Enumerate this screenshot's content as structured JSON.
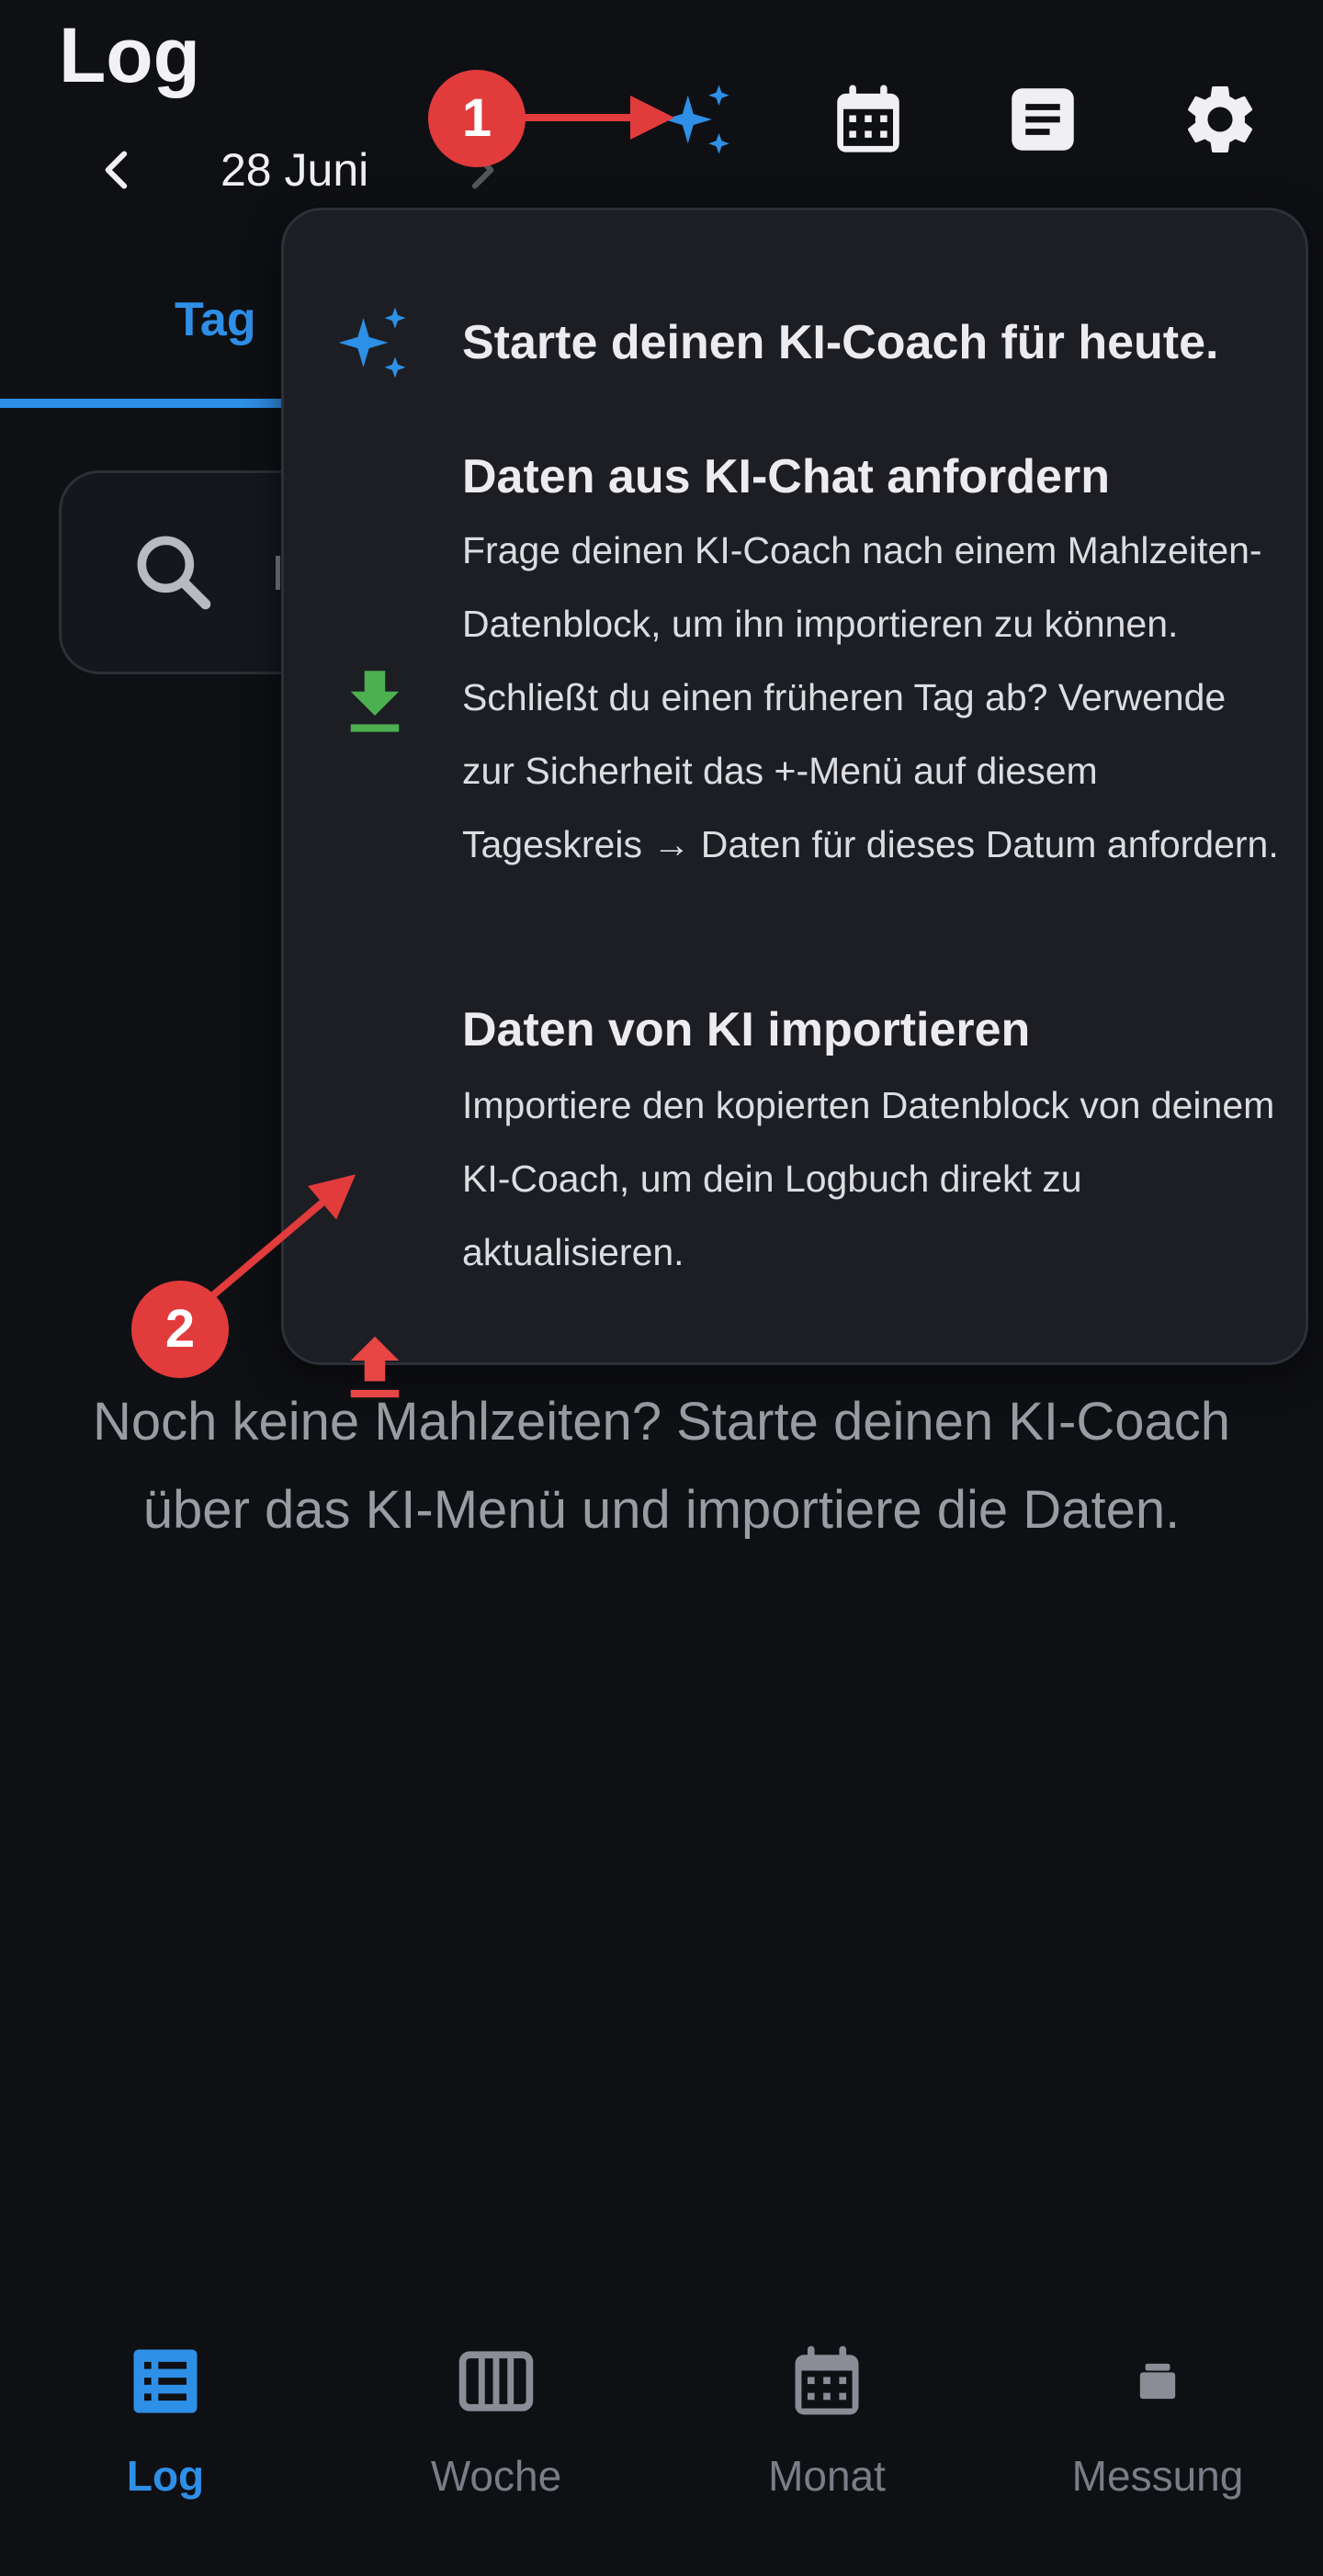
{
  "header": {
    "title": "Log",
    "date": "28 Juni"
  },
  "icons": {
    "prev": "chevron-left-icon",
    "next": "chevron-right-icon",
    "ai": "sparkles-icon",
    "calendar": "calendar-icon",
    "notes": "notes-icon",
    "settings": "gear-icon"
  },
  "tabs": {
    "active": "Tag"
  },
  "search": {
    "placeholder": "I"
  },
  "empty_state": "Noch keine Mahlzeiten? Starte deinen KI-Coach über das KI-Menü und importiere die Daten.",
  "ai_menu": {
    "start_label": "Starte deinen KI-Coach für heute.",
    "request": {
      "title": "Daten aus KI-Chat anfordern",
      "description": "Frage deinen KI-Coach nach einem Mahlzeiten-Datenblock, um ihn importieren zu können. Schließt du einen früheren Tag ab? Verwende zur Sicherheit das +-Menü auf diesem Tageskreis → Daten für dieses Datum anfordern."
    },
    "import": {
      "title": "Daten von KI importieren",
      "description": "Importiere den kopierten Datenblock von deinem KI-Coach, um dein Logbuch direkt zu aktualisieren."
    }
  },
  "annotations": {
    "badge1": "1",
    "badge2": "2"
  },
  "bottom_nav": {
    "items": [
      {
        "label": "Log",
        "icon": "list-icon",
        "active": true
      },
      {
        "label": "Woche",
        "icon": "week-columns-icon",
        "active": false
      },
      {
        "label": "Monat",
        "icon": "calendar-icon",
        "active": false
      },
      {
        "label": "Messung",
        "icon": "scale-icon",
        "active": false
      }
    ]
  },
  "colors": {
    "background": "#0f1014",
    "accent": "#2e8fe6",
    "popup": "#1c1e24",
    "download": "#4caf50",
    "upload": "#e84545",
    "badge": "#e23b3b"
  }
}
